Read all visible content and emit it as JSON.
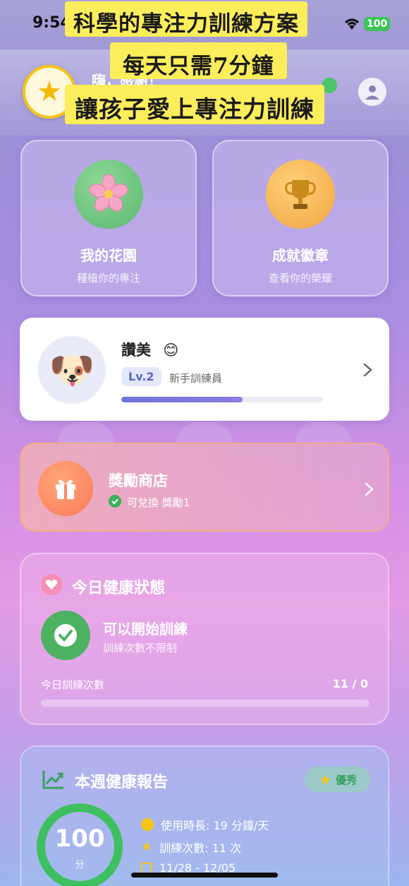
{
  "status_bar": {
    "time": "9:54",
    "battery": "100"
  },
  "promo": {
    "line1": "科學的專注力訓練方案",
    "line2": "每天只需7分鐘",
    "line3": "讓孩子愛上專注力訓練"
  },
  "header": {
    "greeting": "嗨，感謝！"
  },
  "features": [
    {
      "title": "我的花園",
      "subtitle": "種植你的專注",
      "icon": "cherry-blossom-icon"
    },
    {
      "title": "成就徽章",
      "subtitle": "查看你的榮耀",
      "icon": "trophy-icon"
    }
  ],
  "profile": {
    "name": "讚美",
    "name_emoji": "😊",
    "level": "Lv.2",
    "rank": "新手訓練員",
    "avatar_emoji": "🐶",
    "xp_progress": 0.6
  },
  "shop": {
    "title": "獎勵商店",
    "status": "可兌換 獎勵1"
  },
  "health": {
    "title": "今日健康狀態",
    "status_title": "可以開始訓練",
    "status_sub": "訓練次數不限制",
    "count_label": "今日訓練次數",
    "count_value": "11 / 0"
  },
  "report": {
    "title": "本週健康報告",
    "badge": "優秀",
    "score": "100",
    "score_unit": "分",
    "usage": "使用時長: 19 分鐘/天",
    "sessions": "訓練次數: 11 次",
    "date_range": "11/28 - 12/05"
  },
  "colors": {
    "accent_yellow": "#fcee5a",
    "success_green": "#4cb262",
    "gift_orange": "#fb7a58"
  }
}
